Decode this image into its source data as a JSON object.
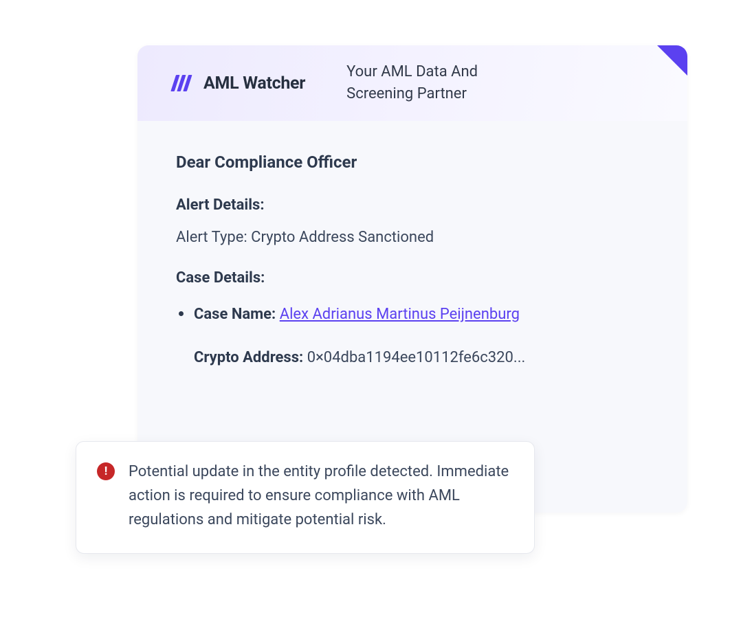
{
  "header": {
    "brand": "AML Watcher",
    "tagline": "Your AML Data And Screening Partner"
  },
  "body": {
    "greeting": "Dear Compliance Officer",
    "alert_details_heading": "Alert Details:",
    "alert_type_label": "Alert Type:",
    "alert_type_value": "Crypto Address Sanctioned",
    "case_details_heading": "Case Details:",
    "case_name_label": "Case Name:",
    "case_name_value": "Alex Adrianus Martinus Peijnenburg",
    "crypto_address_label": "Crypto Address:",
    "crypto_address_value": "0×04dba1194ee10112fe6c320..."
  },
  "callout": {
    "text": "Potential update in the entity profile detected. Immediate action is required to ensure compliance with AML regulations and mitigate potential risk."
  },
  "colors": {
    "accent": "#5b41f0",
    "alert": "#c62728",
    "text": "#2e3a4e"
  }
}
